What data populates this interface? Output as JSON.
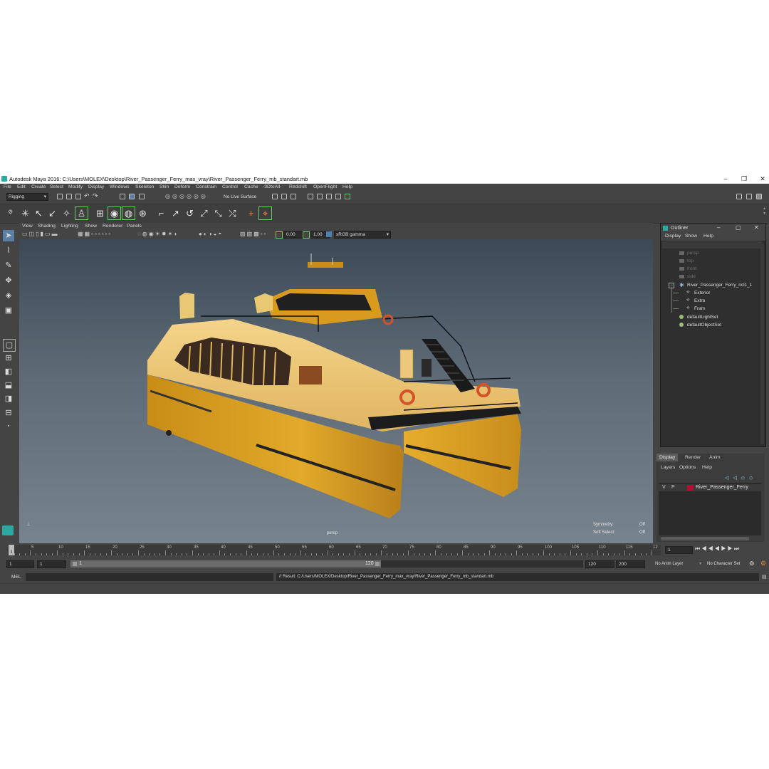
{
  "window": {
    "title": "Autodesk Maya 2016: C:\\Users\\MOLEX\\Desktop\\River_Passenger_Ferry_max_vray\\River_Passenger_Ferry_mb_standart.mb",
    "minimize": "–",
    "maximize": "❐",
    "close": "✕"
  },
  "menubar": [
    "File",
    "Edit",
    "Create",
    "Select",
    "Modify",
    "Display",
    "Windows",
    "Skeleton",
    "Skin",
    "Deform",
    "Constrain",
    "Control",
    "Cache",
    "-3DtoAll-",
    "Redshift",
    "OpenFlight",
    "Help"
  ],
  "statusline": {
    "menuset": "Rigging",
    "live_surface": "No Live Surface"
  },
  "viewport": {
    "menus": [
      "View",
      "Shading",
      "Lighting",
      "Show",
      "Renderer",
      "Panels"
    ],
    "exposure": "0.00",
    "gamma": "1.00",
    "color_space": "sRGB gamma",
    "camera_label": "persp",
    "hud": [
      {
        "label": "Symmetry:",
        "value": "Off"
      },
      {
        "label": "Soft Select:",
        "value": "Off"
      }
    ]
  },
  "outliner": {
    "title": "Outliner",
    "menus": [
      "Display",
      "Show",
      "Help"
    ],
    "items": [
      {
        "label": "persp",
        "dim": true
      },
      {
        "label": "top",
        "dim": true
      },
      {
        "label": "front",
        "dim": true
      },
      {
        "label": "side",
        "dim": true
      },
      {
        "label": "River_Passenger_Ferry_ncl1_1",
        "dim": false
      },
      {
        "label": "Exterior",
        "dim": false
      },
      {
        "label": "Extra",
        "dim": false
      },
      {
        "label": "Fram",
        "dim": false
      },
      {
        "label": "defaultLightSet",
        "dim": false
      },
      {
        "label": "defaultObjectSet",
        "dim": false
      }
    ]
  },
  "layer_editor": {
    "tabs": [
      "Display",
      "Render",
      "Anim"
    ],
    "menus": [
      "Layers",
      "Options",
      "Help"
    ],
    "layer": {
      "v": "V",
      "p": "P",
      "name": "River_Passenger_Ferry",
      "color": "#b01030"
    }
  },
  "timeslider": {
    "ticks": [
      "1",
      "5",
      "10",
      "15",
      "20",
      "25",
      "30",
      "35",
      "40",
      "45",
      "50",
      "55",
      "60",
      "65",
      "70",
      "75",
      "80",
      "85",
      "90",
      "95",
      "100",
      "105",
      "110",
      "115",
      "12"
    ],
    "current_frame": "1",
    "current_time_field": "1"
  },
  "range": {
    "start": "1",
    "start_inner": "1",
    "range_start_label": "1",
    "range_end_label": "120",
    "end_inner": "120",
    "end": "200",
    "anim_layer": "No Anim Layer",
    "character_set": "No Character Set"
  },
  "commandline": {
    "type": "MEL",
    "result": "// Result: C:/Users/MOLEX/Desktop/River_Passenger_Ferry_max_vray/River_Passenger_Ferry_mb_standart.mb"
  },
  "colors": {
    "ui_bg": "#444444",
    "hull": "#d9a024",
    "accent_green": "#6dc96a",
    "maya_teal": "#2aa9a3"
  }
}
